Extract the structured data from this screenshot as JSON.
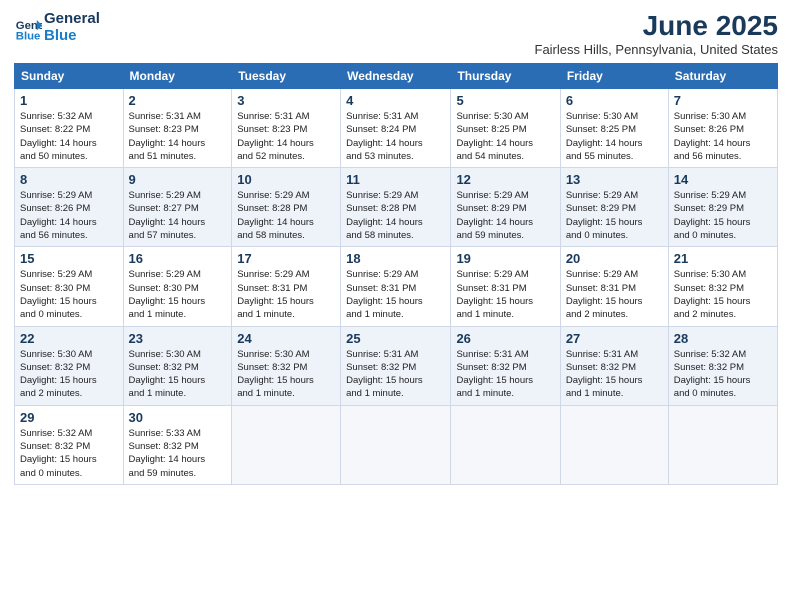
{
  "header": {
    "logo_line1": "General",
    "logo_line2": "Blue",
    "month_title": "June 2025",
    "location": "Fairless Hills, Pennsylvania, United States"
  },
  "weekdays": [
    "Sunday",
    "Monday",
    "Tuesday",
    "Wednesday",
    "Thursday",
    "Friday",
    "Saturday"
  ],
  "weeks": [
    [
      {
        "day": "1",
        "info": "Sunrise: 5:32 AM\nSunset: 8:22 PM\nDaylight: 14 hours\nand 50 minutes."
      },
      {
        "day": "2",
        "info": "Sunrise: 5:31 AM\nSunset: 8:23 PM\nDaylight: 14 hours\nand 51 minutes."
      },
      {
        "day": "3",
        "info": "Sunrise: 5:31 AM\nSunset: 8:23 PM\nDaylight: 14 hours\nand 52 minutes."
      },
      {
        "day": "4",
        "info": "Sunrise: 5:31 AM\nSunset: 8:24 PM\nDaylight: 14 hours\nand 53 minutes."
      },
      {
        "day": "5",
        "info": "Sunrise: 5:30 AM\nSunset: 8:25 PM\nDaylight: 14 hours\nand 54 minutes."
      },
      {
        "day": "6",
        "info": "Sunrise: 5:30 AM\nSunset: 8:25 PM\nDaylight: 14 hours\nand 55 minutes."
      },
      {
        "day": "7",
        "info": "Sunrise: 5:30 AM\nSunset: 8:26 PM\nDaylight: 14 hours\nand 56 minutes."
      }
    ],
    [
      {
        "day": "8",
        "info": "Sunrise: 5:29 AM\nSunset: 8:26 PM\nDaylight: 14 hours\nand 56 minutes."
      },
      {
        "day": "9",
        "info": "Sunrise: 5:29 AM\nSunset: 8:27 PM\nDaylight: 14 hours\nand 57 minutes."
      },
      {
        "day": "10",
        "info": "Sunrise: 5:29 AM\nSunset: 8:28 PM\nDaylight: 14 hours\nand 58 minutes."
      },
      {
        "day": "11",
        "info": "Sunrise: 5:29 AM\nSunset: 8:28 PM\nDaylight: 14 hours\nand 58 minutes."
      },
      {
        "day": "12",
        "info": "Sunrise: 5:29 AM\nSunset: 8:29 PM\nDaylight: 14 hours\nand 59 minutes."
      },
      {
        "day": "13",
        "info": "Sunrise: 5:29 AM\nSunset: 8:29 PM\nDaylight: 15 hours\nand 0 minutes."
      },
      {
        "day": "14",
        "info": "Sunrise: 5:29 AM\nSunset: 8:29 PM\nDaylight: 15 hours\nand 0 minutes."
      }
    ],
    [
      {
        "day": "15",
        "info": "Sunrise: 5:29 AM\nSunset: 8:30 PM\nDaylight: 15 hours\nand 0 minutes."
      },
      {
        "day": "16",
        "info": "Sunrise: 5:29 AM\nSunset: 8:30 PM\nDaylight: 15 hours\nand 1 minute."
      },
      {
        "day": "17",
        "info": "Sunrise: 5:29 AM\nSunset: 8:31 PM\nDaylight: 15 hours\nand 1 minute."
      },
      {
        "day": "18",
        "info": "Sunrise: 5:29 AM\nSunset: 8:31 PM\nDaylight: 15 hours\nand 1 minute."
      },
      {
        "day": "19",
        "info": "Sunrise: 5:29 AM\nSunset: 8:31 PM\nDaylight: 15 hours\nand 1 minute."
      },
      {
        "day": "20",
        "info": "Sunrise: 5:29 AM\nSunset: 8:31 PM\nDaylight: 15 hours\nand 2 minutes."
      },
      {
        "day": "21",
        "info": "Sunrise: 5:30 AM\nSunset: 8:32 PM\nDaylight: 15 hours\nand 2 minutes."
      }
    ],
    [
      {
        "day": "22",
        "info": "Sunrise: 5:30 AM\nSunset: 8:32 PM\nDaylight: 15 hours\nand 2 minutes."
      },
      {
        "day": "23",
        "info": "Sunrise: 5:30 AM\nSunset: 8:32 PM\nDaylight: 15 hours\nand 1 minute."
      },
      {
        "day": "24",
        "info": "Sunrise: 5:30 AM\nSunset: 8:32 PM\nDaylight: 15 hours\nand 1 minute."
      },
      {
        "day": "25",
        "info": "Sunrise: 5:31 AM\nSunset: 8:32 PM\nDaylight: 15 hours\nand 1 minute."
      },
      {
        "day": "26",
        "info": "Sunrise: 5:31 AM\nSunset: 8:32 PM\nDaylight: 15 hours\nand 1 minute."
      },
      {
        "day": "27",
        "info": "Sunrise: 5:31 AM\nSunset: 8:32 PM\nDaylight: 15 hours\nand 1 minute."
      },
      {
        "day": "28",
        "info": "Sunrise: 5:32 AM\nSunset: 8:32 PM\nDaylight: 15 hours\nand 0 minutes."
      }
    ],
    [
      {
        "day": "29",
        "info": "Sunrise: 5:32 AM\nSunset: 8:32 PM\nDaylight: 15 hours\nand 0 minutes."
      },
      {
        "day": "30",
        "info": "Sunrise: 5:33 AM\nSunset: 8:32 PM\nDaylight: 14 hours\nand 59 minutes."
      },
      {
        "day": "",
        "info": ""
      },
      {
        "day": "",
        "info": ""
      },
      {
        "day": "",
        "info": ""
      },
      {
        "day": "",
        "info": ""
      },
      {
        "day": "",
        "info": ""
      }
    ]
  ]
}
